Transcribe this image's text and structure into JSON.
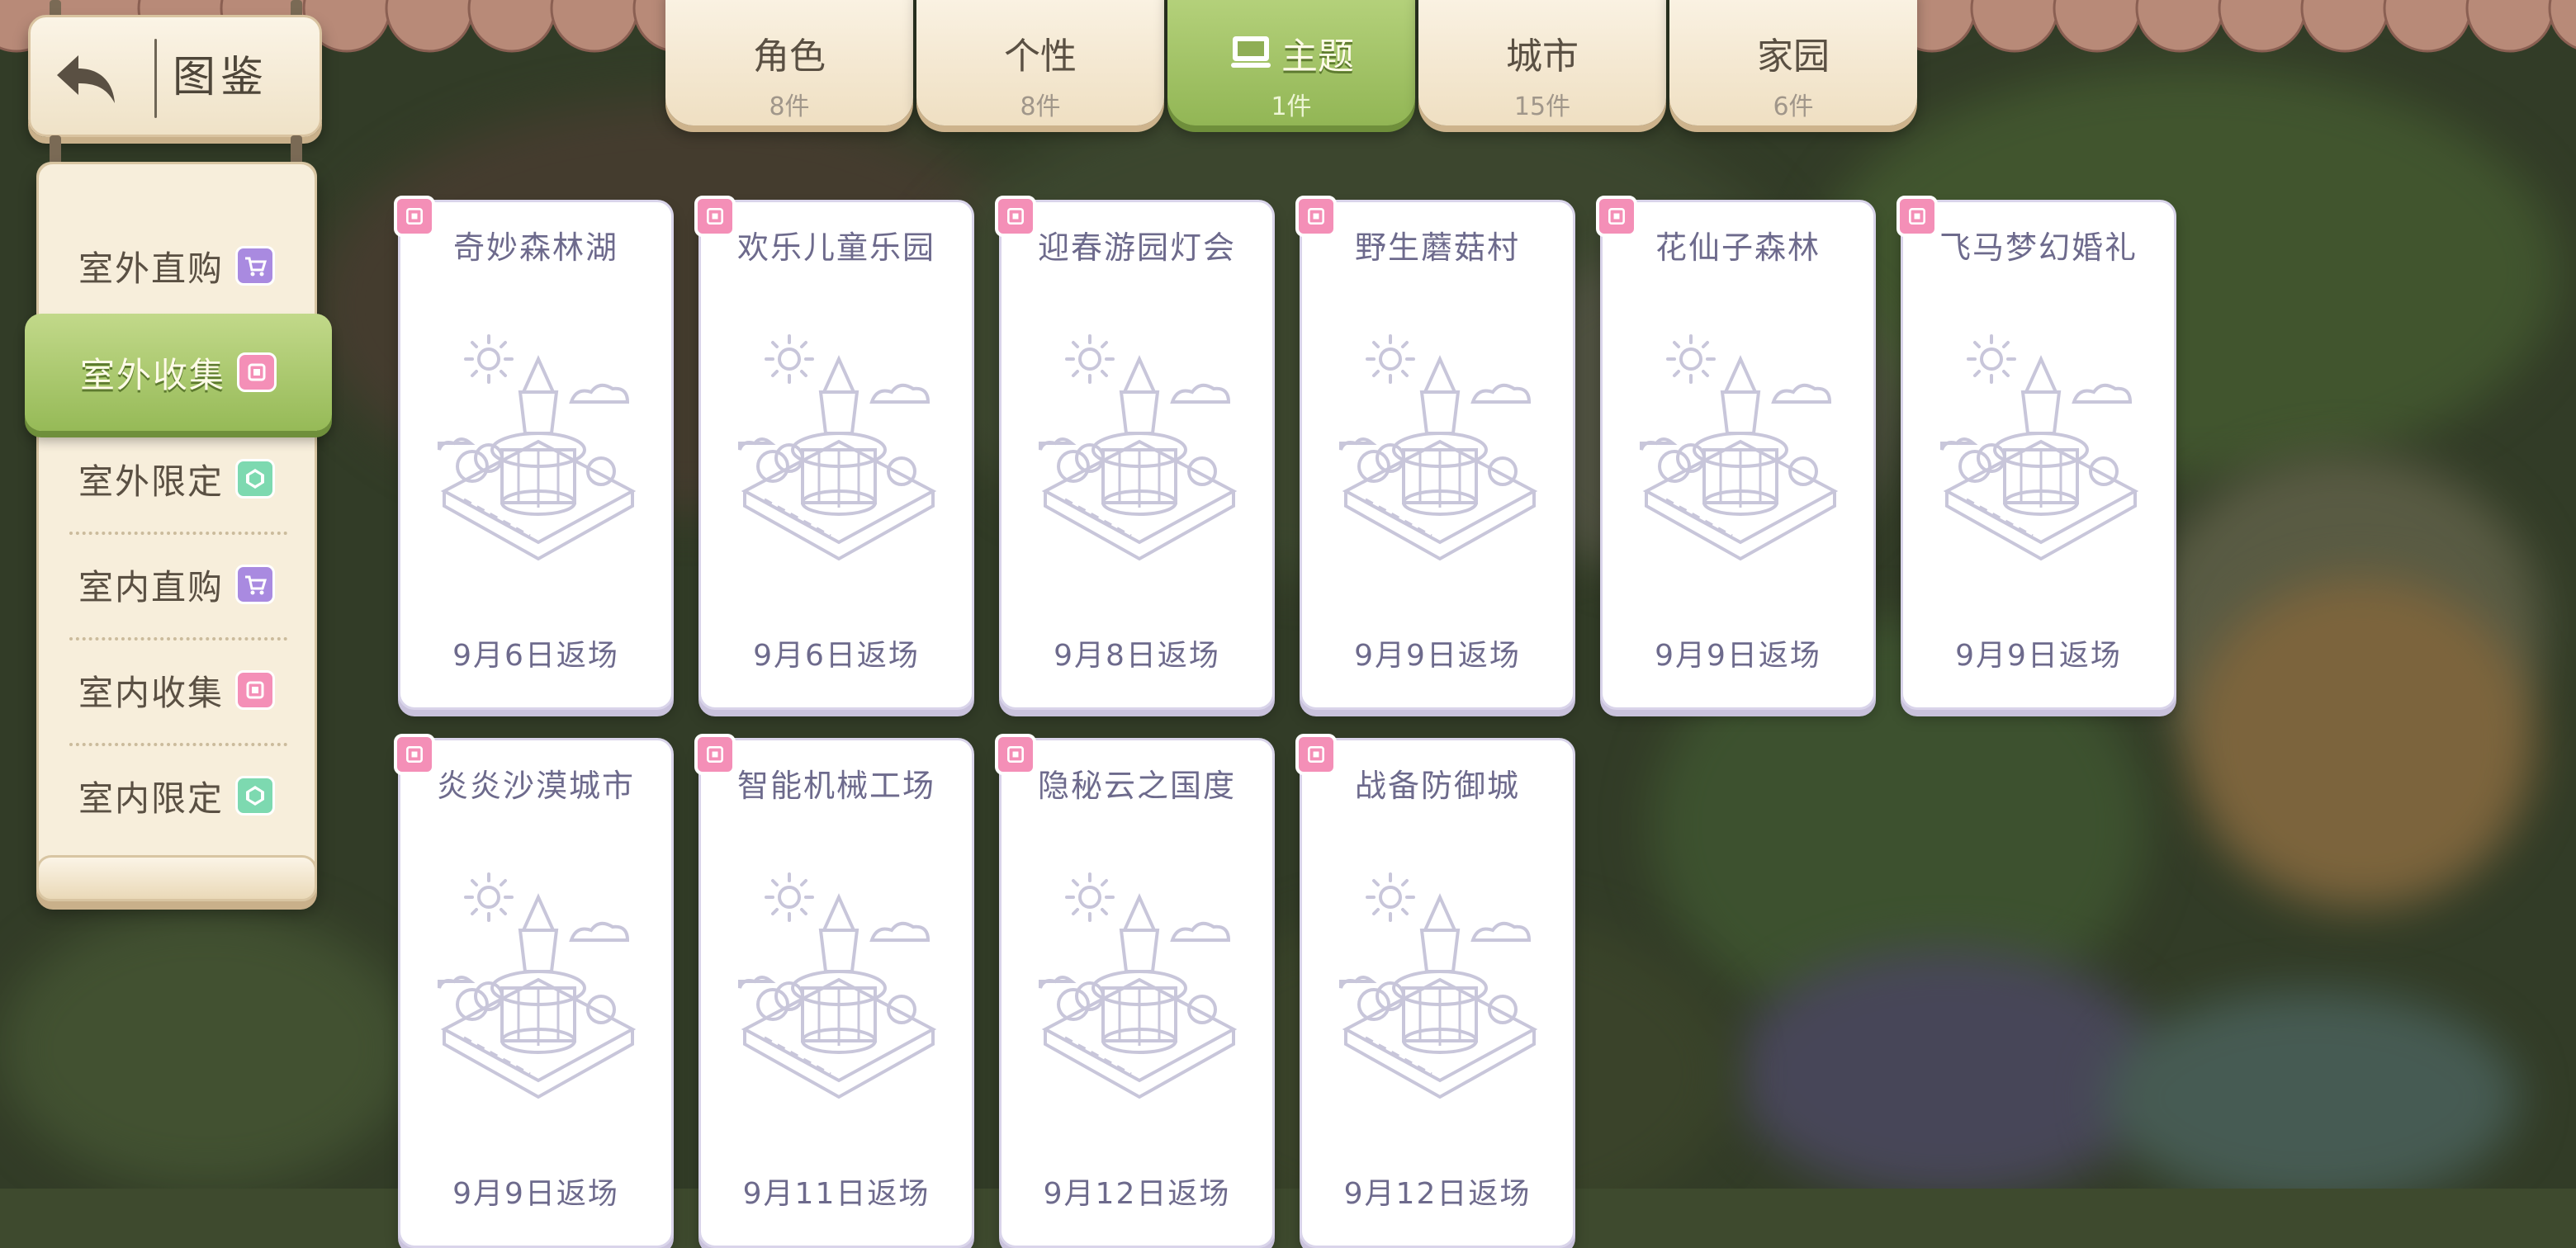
{
  "title_sign": {
    "title": "图鉴"
  },
  "tabs": [
    {
      "label": "角色",
      "count": "8件"
    },
    {
      "label": "个性",
      "count": "8件"
    },
    {
      "label": "主题",
      "count": "1件",
      "active": true,
      "icon": "theme-screen-icon"
    },
    {
      "label": "城市",
      "count": "15件"
    },
    {
      "label": "家园",
      "count": "6件"
    }
  ],
  "categories": [
    {
      "label": "室外直购",
      "icon": "shop-cart-icon"
    },
    {
      "label": "室外收集",
      "icon": "collect-frame-icon",
      "active": true
    },
    {
      "label": "室外限定",
      "icon": "limited-gem-icon"
    },
    {
      "label": "室内直购",
      "icon": "shop-cart-icon"
    },
    {
      "label": "室内收集",
      "icon": "collect-frame-icon"
    },
    {
      "label": "室内限定",
      "icon": "limited-gem-icon"
    }
  ],
  "cards": [
    {
      "name": "奇妙森林湖",
      "date": "9月6日返场"
    },
    {
      "name": "欢乐儿童乐园",
      "date": "9月6日返场"
    },
    {
      "name": "迎春游园灯会",
      "date": "9月8日返场"
    },
    {
      "name": "野生蘑菇村",
      "date": "9月9日返场"
    },
    {
      "name": "花仙子森林",
      "date": "9月9日返场"
    },
    {
      "name": "飞马梦幻婚礼",
      "date": "9月9日返场"
    },
    {
      "name": "炎炎沙漠城市",
      "date": "9月9日返场"
    },
    {
      "name": "智能机械工场",
      "date": "9月11日返场"
    },
    {
      "name": "隐秘云之国度",
      "date": "9月12日返场"
    },
    {
      "name": "战备防御城",
      "date": "9月12日返场"
    }
  ],
  "colors": {
    "active_green": "#a3c465",
    "cream": "#f7eedb",
    "card_text": "#6d6a8c",
    "collect_pink": "#f48fb7",
    "cart_purple": "#a98ae0",
    "limited_teal": "#7dd9b0"
  }
}
